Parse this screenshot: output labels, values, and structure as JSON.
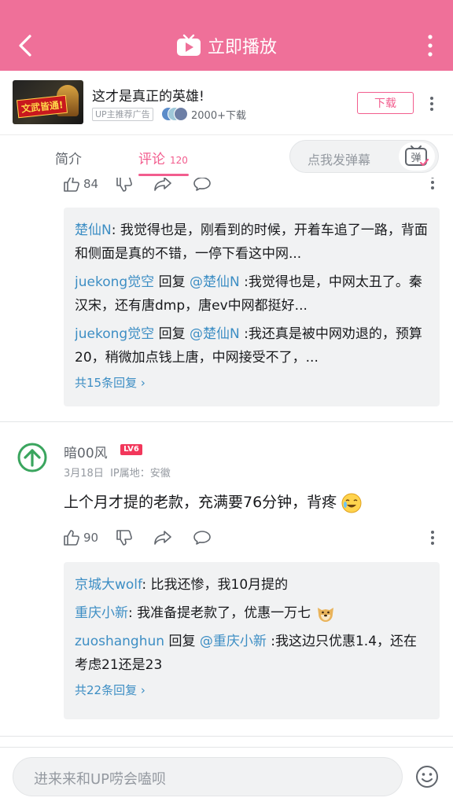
{
  "header": {
    "title": "立即播放",
    "accent": "#ef7099"
  },
  "ad": {
    "thumb_text": "文武皆通!",
    "title": "这才是真正的英雄!",
    "badge": "UP主推荐广告",
    "download_count": "2000+下载",
    "download_label": "下载"
  },
  "tabs": {
    "intro": "简介",
    "comments": "评论",
    "comments_count": "120",
    "danmaku_placeholder": "点我发弹幕",
    "danmaku_button": "弹"
  },
  "comment1": {
    "likes": "84",
    "replies": [
      {
        "user": "楚仙N",
        "text": ": 我觉得也是，刚看到的时候，开着车追了一路，背面和侧面是真的不错，一停下看这中网..."
      },
      {
        "user": "juekong觉空",
        "reply_word": " 回复 ",
        "at": "@楚仙N",
        "text": " :我觉得也是，中网太丑了。秦汉宋，还有唐dmp，唐ev中网都挺好..."
      },
      {
        "user": "juekong觉空",
        "reply_word": " 回复 ",
        "at": "@楚仙N",
        "text": " :我还真是被中网劝退的，预算20，稍微加点钱上唐，中网接受不了，..."
      }
    ],
    "more_replies": "共15条回复"
  },
  "comment2": {
    "username": "暗00风",
    "level": "LV6",
    "date": "3月18日",
    "ip": "IP属地：安徽",
    "body": "上个月才提的老款，充满要76分钟，背疼",
    "likes": "90",
    "replies": [
      {
        "user": "京城大wolf",
        "text": ": 比我还惨，我10月提的"
      },
      {
        "user": "重庆小新",
        "text": ": 我准备提老款了，优惠一万七"
      },
      {
        "user": "zuoshanghun",
        "reply_word": " 回复 ",
        "at": "@重庆小新",
        "text": " :我这边只优惠1.4，还在考虑21还是23"
      }
    ],
    "more_replies": "共22条回复"
  },
  "bottom": {
    "placeholder": "进来来和UP唠会嗑呗"
  }
}
